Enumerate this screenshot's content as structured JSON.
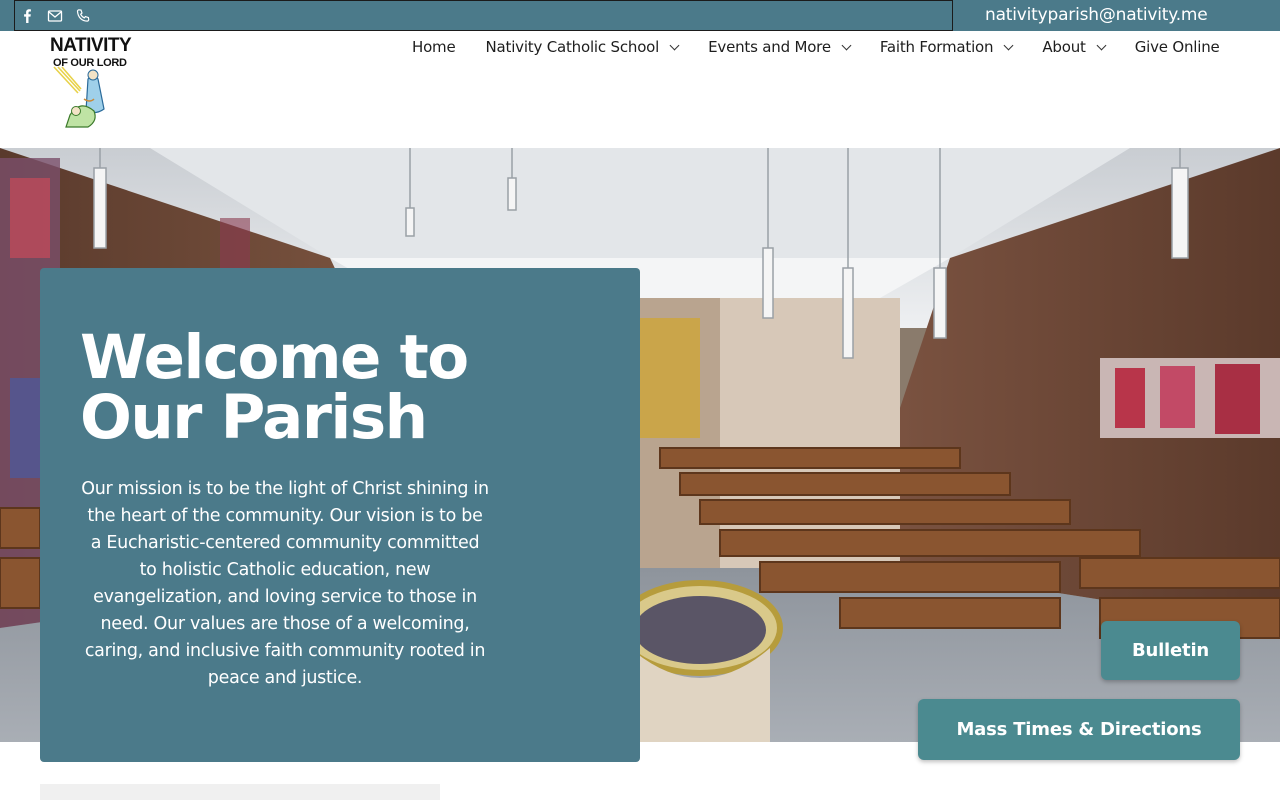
{
  "topbar": {
    "email": "nativityparish@nativity.me",
    "icons": [
      "facebook-icon",
      "email-icon",
      "phone-icon"
    ]
  },
  "header": {
    "logo_title": "NATIVITY",
    "logo_subtitle": "OF OUR LORD"
  },
  "nav": {
    "items": [
      {
        "label": "Home",
        "has_dropdown": false
      },
      {
        "label": "Nativity Catholic School",
        "has_dropdown": true
      },
      {
        "label": "Events and More",
        "has_dropdown": true
      },
      {
        "label": "Faith Formation",
        "has_dropdown": true
      },
      {
        "label": "About",
        "has_dropdown": true
      },
      {
        "label": "Give Online",
        "has_dropdown": false
      }
    ]
  },
  "hero": {
    "title_line1": "Welcome to",
    "title_line2": "Our Parish",
    "mission": "Our mission is to be the light of Christ shining in the heart of the community. Our vision is to be a Eucharistic-centered community committed to holistic Catholic education, new evangelization, and loving service to those in need. Our values are those of a welcoming, caring, and inclusive faith community rooted in peace and justice."
  },
  "buttons": {
    "bulletin": "Bulletin",
    "mass_times": "Mass Times & Directions"
  },
  "colors": {
    "brand_teal": "#4b7a8a",
    "button_teal": "#4b8a90",
    "white": "#ffffff"
  }
}
